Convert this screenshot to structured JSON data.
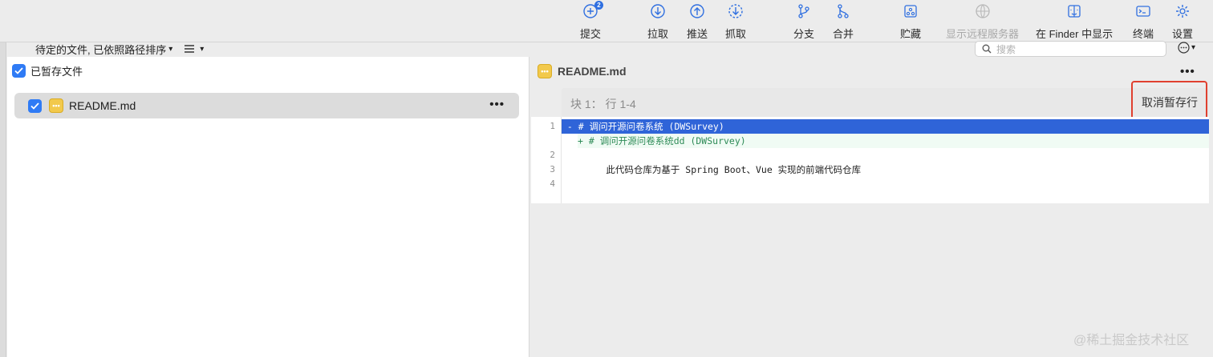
{
  "toolbar": {
    "buttons": [
      {
        "label": "提交",
        "icon": "commit-icon",
        "badge": "2"
      },
      {
        "label": "拉取",
        "icon": "pull-icon"
      },
      {
        "label": "推送",
        "icon": "push-icon"
      },
      {
        "label": "抓取",
        "icon": "fetch-icon"
      },
      {
        "label": "分支",
        "icon": "branch-icon"
      },
      {
        "label": "合并",
        "icon": "merge-icon"
      },
      {
        "label": "贮藏",
        "icon": "stash-icon"
      },
      {
        "label": "显示远程服务器",
        "icon": "remote-icon",
        "disabled": true
      },
      {
        "label": "在 Finder 中显示",
        "icon": "finder-icon"
      },
      {
        "label": "终端",
        "icon": "terminal-icon"
      },
      {
        "label": "设置",
        "icon": "gear-icon"
      }
    ]
  },
  "sort": {
    "label": "待定的文件, 已依照路径排序"
  },
  "left_panel": {
    "staged_header": "已暂存文件",
    "files": [
      {
        "name": "README.md",
        "checked": true
      }
    ]
  },
  "search": {
    "placeholder": "搜索"
  },
  "right_panel": {
    "file_name": "README.md",
    "hunk_label": "块 1： 行 1-4",
    "unstage_button": "取消暂存行",
    "diff_lines": [
      {
        "num": "1",
        "type": "removed",
        "text": " - # 调问开源问卷系统 (DWSurvey)"
      },
      {
        "num": "",
        "type": "added",
        "text": "+ # 调问开源问卷系统dd (DWSurvey)"
      },
      {
        "num": "2",
        "type": "ctx",
        "text": ""
      },
      {
        "num": "3",
        "type": "ctx",
        "text": "        此代码仓库为基于 Spring Boot、Vue 实现的前端代码仓库"
      },
      {
        "num": "4",
        "type": "ctx",
        "text": ""
      }
    ]
  },
  "watermark": "@稀土掘金技术社区",
  "colors": {
    "accent": "#2f7bf5",
    "removed_bg": "#2f64d8",
    "added_text": "#2e8b57",
    "highlight_box": "#e0402f"
  }
}
